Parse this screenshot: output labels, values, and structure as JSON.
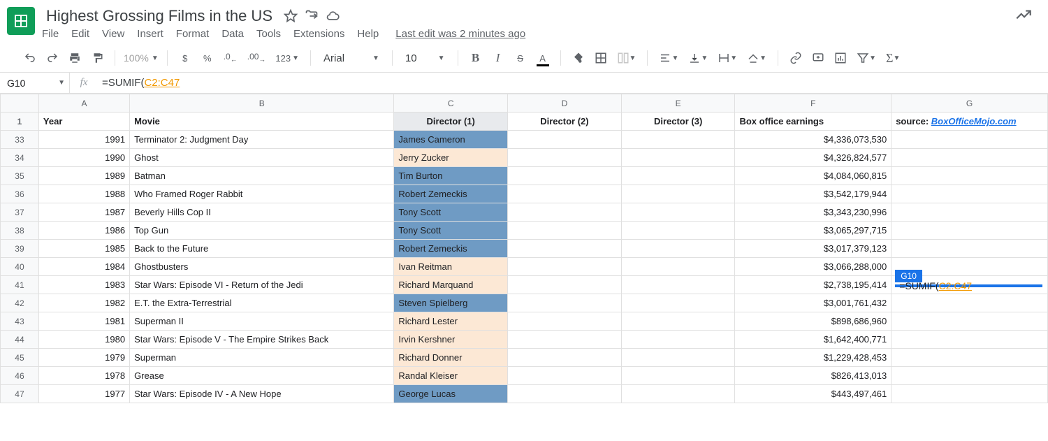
{
  "doc": {
    "title": "Highest Grossing Films in the US"
  },
  "menu": {
    "file": "File",
    "edit": "Edit",
    "view": "View",
    "insert": "Insert",
    "format": "Format",
    "data": "Data",
    "tools": "Tools",
    "extensions": "Extensions",
    "help": "Help",
    "last_edit": "Last edit was 2 minutes ago"
  },
  "toolbar": {
    "zoom": "100%",
    "dollar": "$",
    "percent": "%",
    "dec_dec": ".0",
    "dec_inc": ".00",
    "fmt123": "123",
    "font": "Arial",
    "font_size": "10",
    "bold": "B",
    "italic": "I",
    "strike": "S",
    "textcolor": "A"
  },
  "namebox": {
    "ref": "G10"
  },
  "formula": {
    "fn": "=SUMIF",
    "paren": "(",
    "range": "C2:C47"
  },
  "colheads": {
    "A": "A",
    "B": "B",
    "C": "C",
    "D": "D",
    "E": "E",
    "F": "F",
    "G": "G"
  },
  "sheet_headers": {
    "year": "Year",
    "movie": "Movie",
    "d1": "Director (1)",
    "d2": "Director (2)",
    "d3": "Director (3)",
    "earnings": "Box office earnings",
    "source_label": "source: ",
    "source_link": "BoxOfficeMojo.com"
  },
  "rows": [
    {
      "n": "33",
      "year": "1991",
      "movie": "Terminator 2: Judgment Day",
      "dir": "James Cameron",
      "earn": "$4,336,073,530",
      "shade": "blue"
    },
    {
      "n": "34",
      "year": "1990",
      "movie": "Ghost",
      "dir": "Jerry Zucker",
      "earn": "$4,326,824,577",
      "shade": "cream"
    },
    {
      "n": "35",
      "year": "1989",
      "movie": "Batman",
      "dir": "Tim Burton",
      "earn": "$4,084,060,815",
      "shade": "blue"
    },
    {
      "n": "36",
      "year": "1988",
      "movie": "Who Framed Roger Rabbit",
      "dir": "Robert Zemeckis",
      "earn": "$3,542,179,944",
      "shade": "blue"
    },
    {
      "n": "37",
      "year": "1987",
      "movie": "Beverly Hills Cop II",
      "dir": "Tony Scott",
      "earn": "$3,343,230,996",
      "shade": "blue"
    },
    {
      "n": "38",
      "year": "1986",
      "movie": "Top Gun",
      "dir": "Tony Scott",
      "earn": "$3,065,297,715",
      "shade": "blue"
    },
    {
      "n": "39",
      "year": "1985",
      "movie": "Back to the Future",
      "dir": "Robert Zemeckis",
      "earn": "$3,017,379,123",
      "shade": "blue"
    },
    {
      "n": "40",
      "year": "1984",
      "movie": "Ghostbusters",
      "dir": "Ivan Reitman",
      "earn": "$3,066,288,000",
      "shade": "cream"
    },
    {
      "n": "41",
      "year": "1983",
      "movie": "Star Wars: Episode VI - Return of the Jedi",
      "dir": "Richard Marquand",
      "earn": "$2,738,195,414",
      "shade": "cream"
    },
    {
      "n": "42",
      "year": "1982",
      "movie": "E.T. the Extra-Terrestrial",
      "dir": "Steven Spielberg",
      "earn": "$3,001,761,432",
      "shade": "blue"
    },
    {
      "n": "43",
      "year": "1981",
      "movie": "Superman II",
      "dir": "Richard Lester",
      "earn": "$898,686,960",
      "shade": "cream"
    },
    {
      "n": "44",
      "year": "1980",
      "movie": "Star Wars: Episode V - The Empire Strikes Back",
      "dir": "Irvin Kershner",
      "earn": "$1,642,400,771",
      "shade": "cream"
    },
    {
      "n": "45",
      "year": "1979",
      "movie": "Superman",
      "dir": "Richard Donner",
      "earn": "$1,229,428,453",
      "shade": "cream"
    },
    {
      "n": "46",
      "year": "1978",
      "movie": "Grease",
      "dir": "Randal Kleiser",
      "earn": "$826,413,013",
      "shade": "cream"
    },
    {
      "n": "47",
      "year": "1977",
      "movie": "Star Wars: Episode IV - A New Hope",
      "dir": "George Lucas",
      "earn": "$443,497,461",
      "shade": "blue"
    }
  ],
  "active_cell": {
    "badge": "G10",
    "row_index": 8,
    "formula_fn": "=SUMIF",
    "formula_paren": "(",
    "formula_range": "C2:C47"
  }
}
